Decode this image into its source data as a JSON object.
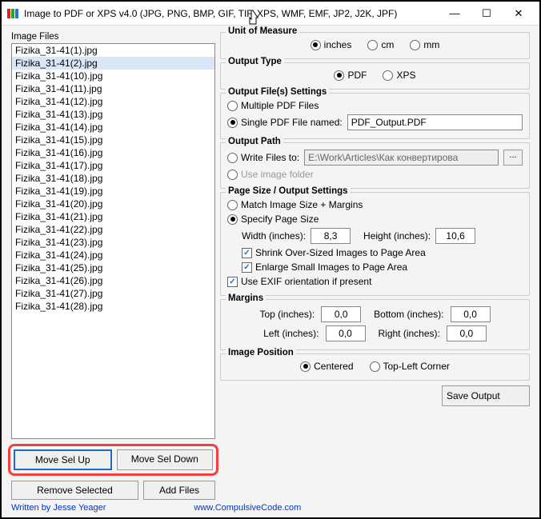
{
  "window": {
    "title": "Image to PDF or XPS  v4.0   (JPG, PNG, BMP, GIF, TIF, XPS, WMF, EMF, JP2, J2K, JPF)"
  },
  "left": {
    "heading": "Image Files",
    "files": [
      "Fizika_31-41(1).jpg",
      "Fizika_31-41(2).jpg",
      "Fizika_31-41(10).jpg",
      "Fizika_31-41(11).jpg",
      "Fizika_31-41(12).jpg",
      "Fizika_31-41(13).jpg",
      "Fizika_31-41(14).jpg",
      "Fizika_31-41(15).jpg",
      "Fizika_31-41(16).jpg",
      "Fizika_31-41(17).jpg",
      "Fizika_31-41(18).jpg",
      "Fizika_31-41(19).jpg",
      "Fizika_31-41(20).jpg",
      "Fizika_31-41(21).jpg",
      "Fizika_31-41(22).jpg",
      "Fizika_31-41(23).jpg",
      "Fizika_31-41(24).jpg",
      "Fizika_31-41(25).jpg",
      "Fizika_31-41(26).jpg",
      "Fizika_31-41(27).jpg",
      "Fizika_31-41(28).jpg"
    ],
    "selected_index": 1,
    "btn_up": "Move Sel Up",
    "btn_down": "Move Sel Down",
    "btn_remove": "Remove Selected",
    "btn_add": "Add Files"
  },
  "unit": {
    "title": "Unit of Measure",
    "inches": "inches",
    "cm": "cm",
    "mm": "mm"
  },
  "output_type": {
    "title": "Output Type",
    "pdf": "PDF",
    "xps": "XPS"
  },
  "output_file": {
    "title": "Output File(s) Settings",
    "multiple": "Multiple PDF Files",
    "single": "Single PDF File named:",
    "filename": "PDF_Output.PDF"
  },
  "output_path": {
    "title": "Output Path",
    "write_to": "Write Files to:",
    "path_value": "E:\\Work\\Articles\\Как конвертирова",
    "use_image_folder": "Use image folder",
    "browse": "..."
  },
  "page_size": {
    "title": "Page Size / Output Settings",
    "match": "Match Image Size + Margins",
    "specify": "Specify Page Size",
    "width_label": "Width (inches):",
    "width_val": "8,3",
    "height_label": "Height (inches):",
    "height_val": "10,6",
    "shrink": "Shrink Over-Sized Images to Page Area",
    "enlarge": "Enlarge Small Images to Page Area",
    "exif": "Use EXIF orientation if present"
  },
  "margins": {
    "title": "Margins",
    "top": "Top (inches):",
    "top_val": "0,0",
    "bottom": "Bottom (inches):",
    "bottom_val": "0,0",
    "left": "Left (inches):",
    "left_val": "0,0",
    "right": "Right (inches):",
    "right_val": "0,0"
  },
  "position": {
    "title": "Image Position",
    "centered": "Centered",
    "topleft": "Top-Left Corner"
  },
  "footer": {
    "written_by": "Written by Jesse Yeager",
    "url": "www.CompulsiveCode.com",
    "save": "Save Output"
  }
}
